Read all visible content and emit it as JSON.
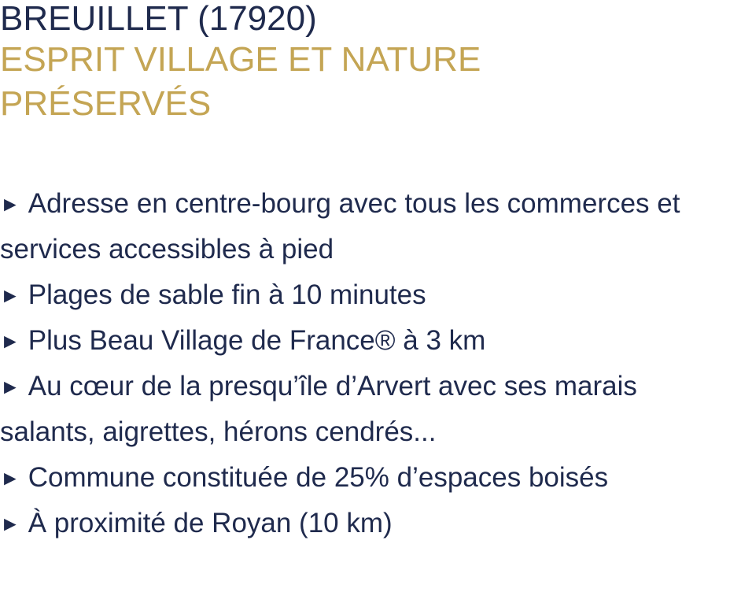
{
  "title": "BREUILLET (17920)",
  "subtitle_line1": "ESPRIT VILLAGE ET NATURE",
  "subtitle_line2": "PRÉSERVÉS",
  "bullet_glyph": "►",
  "colors": {
    "title": "#1f2a4d",
    "subtitle": "#c4a554",
    "body": "#1f2a4d"
  },
  "bullets": [
    "Adresse en centre-bourg avec tous les commerces et services accessibles à pied",
    "Plages de sable fin à 10 minutes",
    "Plus Beau Village de France® à 3 km",
    "Au cœur de la presqu’île d’Arvert avec ses marais salants, aigrettes, hérons cendrés...",
    "Commune constituée de 25% d’espaces boisés",
    "À proximité de Royan (10 km)"
  ]
}
